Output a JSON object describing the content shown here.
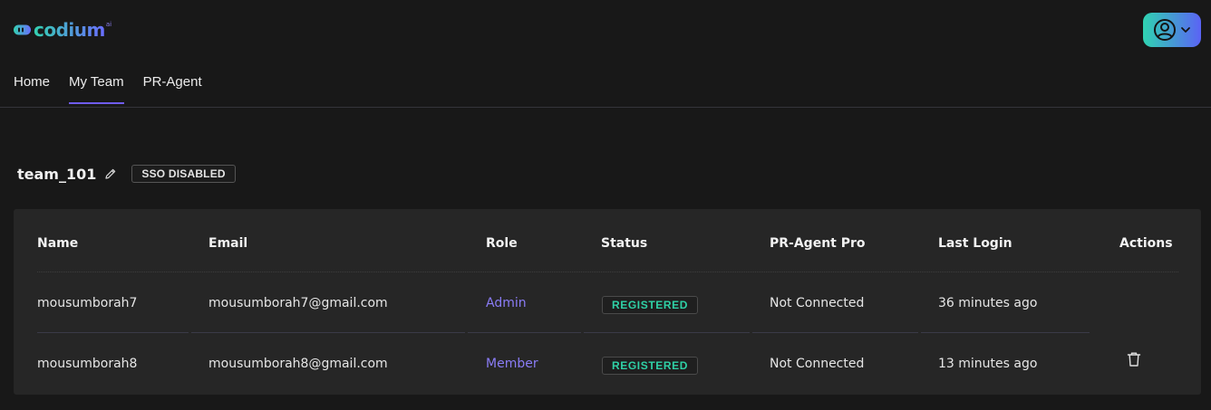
{
  "brand": {
    "name": "codium",
    "superscript": "ai"
  },
  "user_menu": {
    "avatar_icon": "user-circle-icon",
    "chevron_icon": "chevron-down-icon"
  },
  "nav": {
    "tabs": [
      {
        "label": "Home",
        "active": false
      },
      {
        "label": "My Team",
        "active": true
      },
      {
        "label": "PR-Agent",
        "active": false
      }
    ]
  },
  "team": {
    "name": "team_101",
    "sso_status": "SSO DISABLED"
  },
  "table": {
    "columns": [
      "Name",
      "Email",
      "Role",
      "Status",
      "PR-Agent Pro",
      "Last Login",
      "Actions"
    ],
    "rows": [
      {
        "name": "mousumborah7",
        "email": "mousumborah7@gmail.com",
        "role": "Admin",
        "status": "REGISTERED",
        "pr_agent_pro": "Not Connected",
        "last_login": "36 minutes ago",
        "actions": []
      },
      {
        "name": "mousumborah8",
        "email": "mousumborah8@gmail.com",
        "role": "Member",
        "status": "REGISTERED",
        "pr_agent_pro": "Not Connected",
        "last_login": "13 minutes ago",
        "actions": [
          "trash-icon"
        ]
      }
    ]
  },
  "colors": {
    "background": "#181818",
    "card": "#262626",
    "accent": "#6f5cf2",
    "role_link": "#8a7cf6",
    "status_registered": "#2fd1a6",
    "brand_gradient_start": "#33d1b0",
    "brand_gradient_end": "#6a6dff"
  }
}
